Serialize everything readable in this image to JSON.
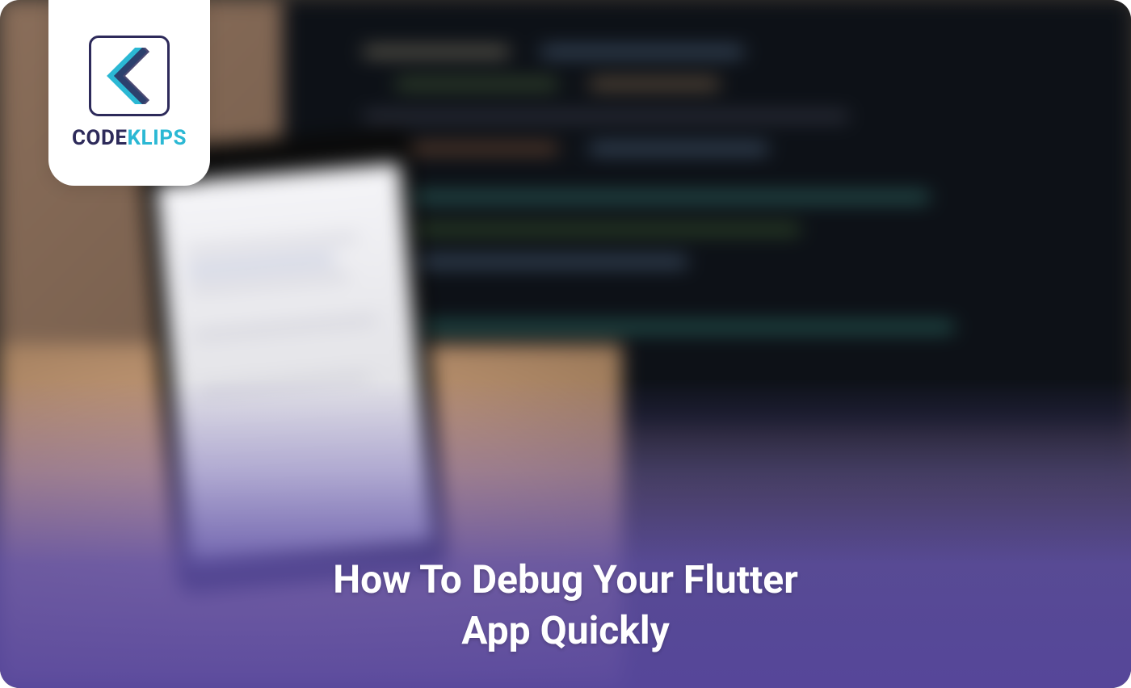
{
  "logo": {
    "brand_part1": "CODE",
    "brand_part2": "KLIPS"
  },
  "hero": {
    "title_line1": "How To Debug Your Flutter",
    "title_line2": "App Quickly"
  },
  "colors": {
    "logo_dark": "#2d2a5a",
    "logo_accent": "#2bb8d4",
    "overlay_purple": "#5f50a8"
  }
}
